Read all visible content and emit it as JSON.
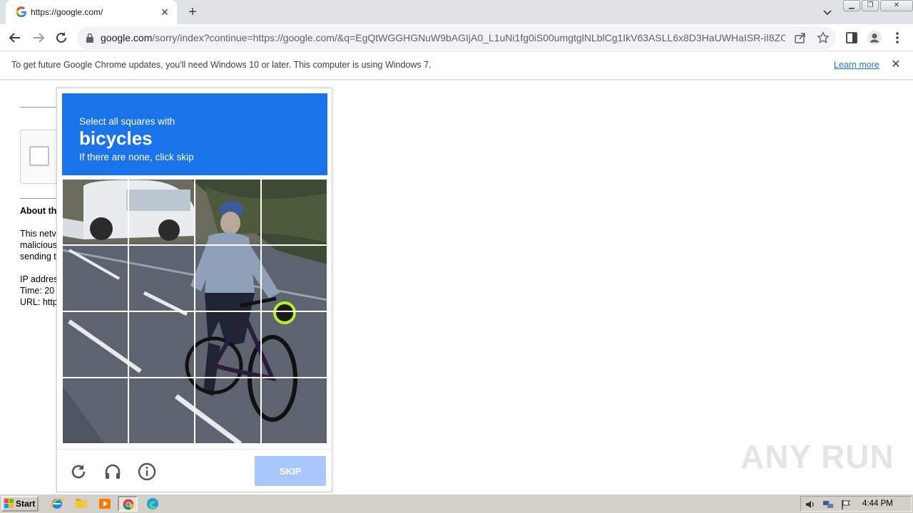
{
  "browser": {
    "tab": {
      "title": "https://google.com/",
      "favicon": "google-g-icon"
    },
    "address": {
      "host": "google.com",
      "path": "/sorry/index?continue=https://google.com/&q=EgQtWGGHGNuW9bAGIjA0_L1uNi1fg0iS00umgtglNLblCg1IkV63ASLL6x8D3HaUWHaISR-iI8ZO..."
    }
  },
  "infobar": {
    "message": "To get future Google Chrome updates, you'll need Windows 10 or later. This computer is using Windows 7.",
    "link": "Learn more"
  },
  "page": {
    "about_heading": "About th",
    "text_lines": [
      "This netv",
      "malicious",
      "sending t"
    ],
    "ip_line": "IP addres",
    "time_line": "Time: 20",
    "url_line": "URL: http"
  },
  "challenge": {
    "instruction": "Select all squares with",
    "target": "bicycles",
    "hint": "If there are none, click skip",
    "skip_label": "SKIP",
    "grid_rows": 4,
    "grid_cols": 4,
    "colors": {
      "header": "#1a73e8",
      "skip": "#a8c7fa"
    }
  },
  "watermark": "ANY RUN",
  "taskbar": {
    "start_label": "Start",
    "clock": "4:44 PM"
  }
}
